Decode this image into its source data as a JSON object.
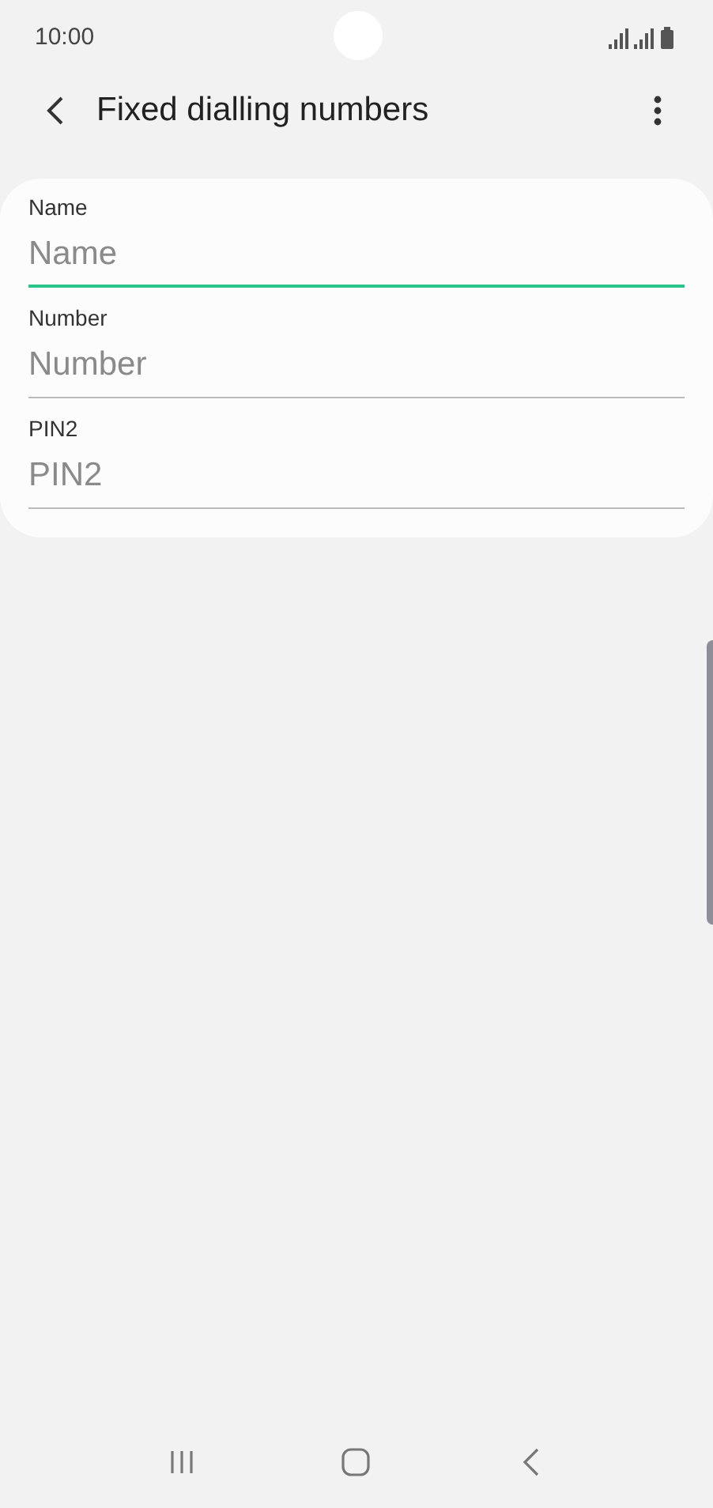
{
  "status_bar": {
    "time": "10:00"
  },
  "header": {
    "title": "Fixed dialling numbers"
  },
  "fields": [
    {
      "label": "Name",
      "placeholder": "Name",
      "focused": true
    },
    {
      "label": "Number",
      "placeholder": "Number",
      "focused": false
    },
    {
      "label": "PIN2",
      "placeholder": "PIN2",
      "focused": false
    }
  ]
}
